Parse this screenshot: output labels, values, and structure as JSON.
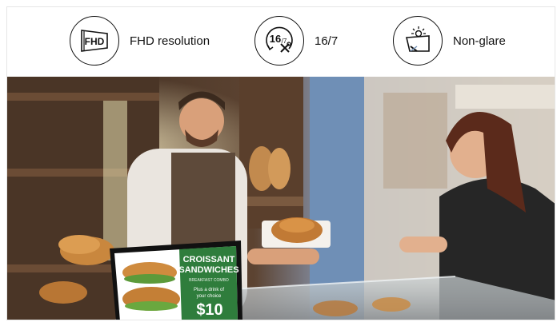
{
  "features": [
    {
      "icon": "fhd-resolution-icon",
      "label": "FHD resolution"
    },
    {
      "icon": "16-7-operation-icon",
      "label": "16/7"
    },
    {
      "icon": "non-glare-icon",
      "label": "Non-glare"
    }
  ],
  "icon_text": {
    "fhd": "FHD",
    "hours": "16",
    "days": "/7"
  },
  "promo_sign": {
    "title_line1": "CROISSANT",
    "title_line2": "SANDWICHES",
    "subtitle": "BREAKFAST COMBO",
    "desc_line1": "Plus a drink of",
    "desc_line2": "your choice",
    "price": "$10"
  },
  "colors": {
    "sign_green": "#2f7d3c",
    "accent_blue": "#6f8fb6"
  }
}
